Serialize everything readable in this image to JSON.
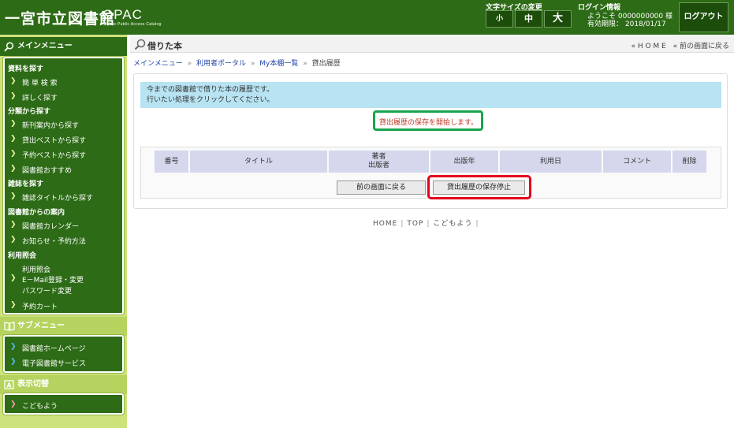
{
  "header": {
    "logo": "一宮市立図書館",
    "opac": "OPAC",
    "opac_sub": "Online Public Access Catalog",
    "font_size_label": "文字サイズの変更",
    "font_small": "小",
    "font_medium": "中",
    "font_large": "大",
    "login_label": "ログイン情報",
    "welcome": "ようこそ 0000000000 様",
    "expiry": "有効期限： 2018/01/17",
    "logout": "ログアウト"
  },
  "sidebar": {
    "main_menu": "メインメニュー",
    "cat_search": "資料を探す",
    "simple_search": "簡 単 検 索",
    "detail_search": "詳しく探す",
    "cat_classify": "分類から探す",
    "new_arrivals": "新刊案内から探す",
    "best_loans": "貸出ベストから探す",
    "best_reserve": "予約ベストから探す",
    "recommend": "図書館おすすめ",
    "cat_magazine": "雑誌を探す",
    "magazine_title": "雑誌タイトルから探す",
    "cat_guide": "図書館からの案内",
    "calendar": "図書館カレンダー",
    "notice": "お知らせ・予約方法",
    "cat_inquiry": "利用照会",
    "inquiry": "利用照会",
    "email_reg": "E－Mail登録・変更",
    "password": "パスワード変更",
    "reserve_cart": "予約カート",
    "sub_menu": "サブメニュー",
    "library_home": "図書館ホームページ",
    "e_library": "電子図書館サービス",
    "display_switch": "表示切替",
    "kids": "こどもよう"
  },
  "main": {
    "title": "借りた本",
    "nav_home": "« H O M E",
    "nav_back": "« 前の画面に戻る",
    "breadcrumb": {
      "main_menu": "メインメニュー",
      "portal": "利用者ポータル",
      "my_shelf": "My本棚一覧",
      "current": "貸出履歴",
      "sep": "»"
    },
    "info_line1": "今までの図書館で借りた本の履歴です。",
    "info_line2": "行いたい処理をクリックしてください。",
    "message": "貸出履歴の保存を開始します。",
    "columns": {
      "number": "番号",
      "title": "タイトル",
      "author": "著者",
      "publisher": "出版者",
      "year": "出版年",
      "date": "利用日",
      "comment": "コメント",
      "delete": "削除"
    },
    "back_button": "前の画面に戻る",
    "stop_button": "貸出履歴の保存停止"
  },
  "footer": {
    "home": "HOME",
    "top": "TOP",
    "kids": "こどもよう",
    "sep": "|"
  }
}
